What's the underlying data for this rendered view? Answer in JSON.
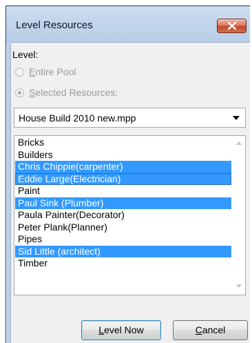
{
  "dialog": {
    "title": "Level Resources",
    "close_icon": "close-x-icon",
    "level_label": "Level:",
    "radios": [
      {
        "mnemonic": "E",
        "rest": "ntire Pool",
        "checked": false,
        "enabled": false
      },
      {
        "mnemonic": "S",
        "rest": "elected Resources:",
        "checked": true,
        "enabled": false
      }
    ],
    "project_select": {
      "value": "House Build 2010 new.mpp"
    },
    "resources": [
      {
        "label": "Bricks",
        "selected": false
      },
      {
        "label": "Builders",
        "selected": false
      },
      {
        "label": "Chris Chippie(carpenter)",
        "selected": true
      },
      {
        "label": "Eddie Large(Electrician)",
        "selected": true,
        "focused": true
      },
      {
        "label": "Paint",
        "selected": false
      },
      {
        "label": "Paul Sink (Plumber)",
        "selected": true
      },
      {
        "label": "Paula Painter(Decorator)",
        "selected": false
      },
      {
        "label": "Peter Plank(Planner)",
        "selected": false
      },
      {
        "label": "Pipes",
        "selected": false
      },
      {
        "label": "Sid Little (architect)",
        "selected": true
      },
      {
        "label": "Timber",
        "selected": false
      }
    ],
    "buttons": {
      "level_now": {
        "mnemonic": "L",
        "rest": "evel Now"
      },
      "cancel": {
        "mnemonic": "C",
        "rest": "ancel"
      }
    },
    "colors": {
      "selection": "#3399ff",
      "frame": "#bcd1e9",
      "close_button": "#c04a2c"
    }
  }
}
